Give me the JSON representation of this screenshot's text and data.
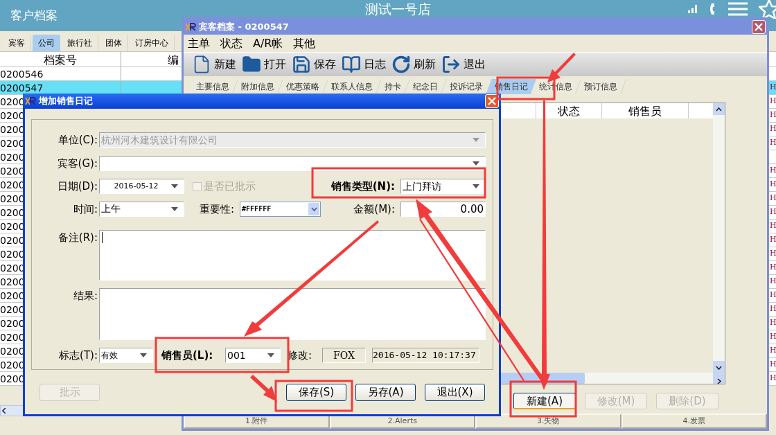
{
  "app": {
    "title": "客户档案",
    "store_name": "测试一号店"
  },
  "category_tabs": [
    {
      "label": "宾客",
      "selected": false
    },
    {
      "label": "公司",
      "selected": true
    },
    {
      "label": "旅行社",
      "selected": false
    },
    {
      "label": "团体",
      "selected": false
    },
    {
      "label": "订房中心",
      "selected": false
    }
  ],
  "archive_table": {
    "columns": [
      "档案号",
      "编"
    ],
    "rows": [
      {
        "id": "0200546",
        "selected": false
      },
      {
        "id": "0200547",
        "selected": true,
        "last_column": "H"
      },
      {
        "id": "0200",
        "selected": false,
        "last_column": "H"
      },
      {
        "id": "0200",
        "selected": false,
        "last_column": "H"
      },
      {
        "id": "0200",
        "selected": false,
        "last_column": "H"
      },
      {
        "id": "0200",
        "selected": false,
        "last_column": "H"
      },
      {
        "id": "0200",
        "selected": false
      },
      {
        "id": "0200",
        "selected": false,
        "last_column": "H"
      },
      {
        "id": "0200",
        "selected": false,
        "last_column": "H"
      },
      {
        "id": "0200",
        "selected": false,
        "last_column": "H"
      },
      {
        "id": "0200",
        "selected": false,
        "last_column": "H"
      },
      {
        "id": "0200",
        "selected": false,
        "last_column": "H"
      },
      {
        "id": "0200",
        "selected": false,
        "last_column": "H"
      },
      {
        "id": "0200",
        "selected": false,
        "last_column": "H"
      },
      {
        "id": "0200",
        "selected": false,
        "last_column": "H"
      },
      {
        "id": "0200",
        "selected": false,
        "last_column": "H"
      },
      {
        "id": "0200",
        "selected": false,
        "last_column": "H"
      },
      {
        "id": "0200",
        "selected": false,
        "last_column": "H"
      },
      {
        "id": "0200",
        "selected": false,
        "last_column": "H"
      },
      {
        "id": "0200",
        "selected": false,
        "last_column": "H"
      },
      {
        "id": "0200",
        "selected": false,
        "last_column": "H"
      },
      {
        "id": "0200",
        "selected": false,
        "last_column": "H"
      },
      {
        "id": "0200",
        "selected": false,
        "last_column": "H"
      }
    ]
  },
  "guest_window": {
    "title": "宾客档案 - 0200547",
    "menu": [
      "主单",
      "状态",
      "A/R帐",
      "其他"
    ],
    "toolbar": [
      {
        "label": "新建",
        "kind": "new"
      },
      {
        "label": "打开",
        "kind": "open"
      },
      {
        "label": "保存",
        "kind": "save"
      },
      {
        "label": "日志",
        "kind": "log"
      },
      {
        "label": "刷新",
        "kind": "refresh"
      },
      {
        "label": "退出",
        "kind": "exit"
      }
    ],
    "tabs": [
      {
        "label": "主要信息",
        "selected": false
      },
      {
        "label": "附加信息",
        "selected": false
      },
      {
        "label": "优惠策略",
        "selected": false
      },
      {
        "label": "联系人信息",
        "selected": false
      },
      {
        "label": "持卡",
        "selected": false
      },
      {
        "label": "纪念日",
        "selected": false
      },
      {
        "label": "投诉记录",
        "selected": false
      },
      {
        "label": "销售日记",
        "selected": true
      },
      {
        "label": "统计信息",
        "selected": false
      },
      {
        "label": "预订信息",
        "selected": false
      }
    ],
    "list_columns": [
      "状态",
      "销售员"
    ],
    "buttons": [
      {
        "label": "新建(A)",
        "disabled": false
      },
      {
        "label": "修改(M)",
        "disabled": true
      },
      {
        "label": "删除(D)",
        "disabled": true
      }
    ],
    "bottom_tabs": [
      "1.附件",
      "2.Alerts",
      "3.失物",
      "4.发票"
    ]
  },
  "dialog": {
    "title": "增加销售日记",
    "unit": {
      "label": "单位(C):",
      "value": "杭州河木建筑设计有限公司",
      "disabled": true
    },
    "guest": {
      "label": "宾客(G):",
      "disabled": false
    },
    "date": {
      "label": "日期(D):",
      "value": "2016-05-12"
    },
    "approved": {
      "label": "是否已批示",
      "checked": false,
      "disabled": true
    },
    "sale_type": {
      "label": "销售类型(N):",
      "value": "上门拜访"
    },
    "time": {
      "label": "时间:",
      "value": "上午"
    },
    "importance": {
      "label": "重要性:",
      "value": "#FFFFFF"
    },
    "amount": {
      "label": "金额(M):",
      "value": "0.00"
    },
    "remark": {
      "label": "备注(R):"
    },
    "result": {
      "label": "结果:"
    },
    "flag": {
      "label": "标志(T):",
      "value": "有效"
    },
    "salesperson": {
      "label": "销售员(L):",
      "value": "001"
    },
    "modified": {
      "label": "修改:",
      "user": "FOX",
      "time": "2016-05-12 10:17:37"
    },
    "buttons": [
      {
        "label": "批示",
        "disabled": true
      },
      {
        "label": "保存(S)",
        "disabled": false
      },
      {
        "label": "另存(A)",
        "disabled": false
      },
      {
        "label": "退出(X)",
        "disabled": false
      }
    ]
  }
}
